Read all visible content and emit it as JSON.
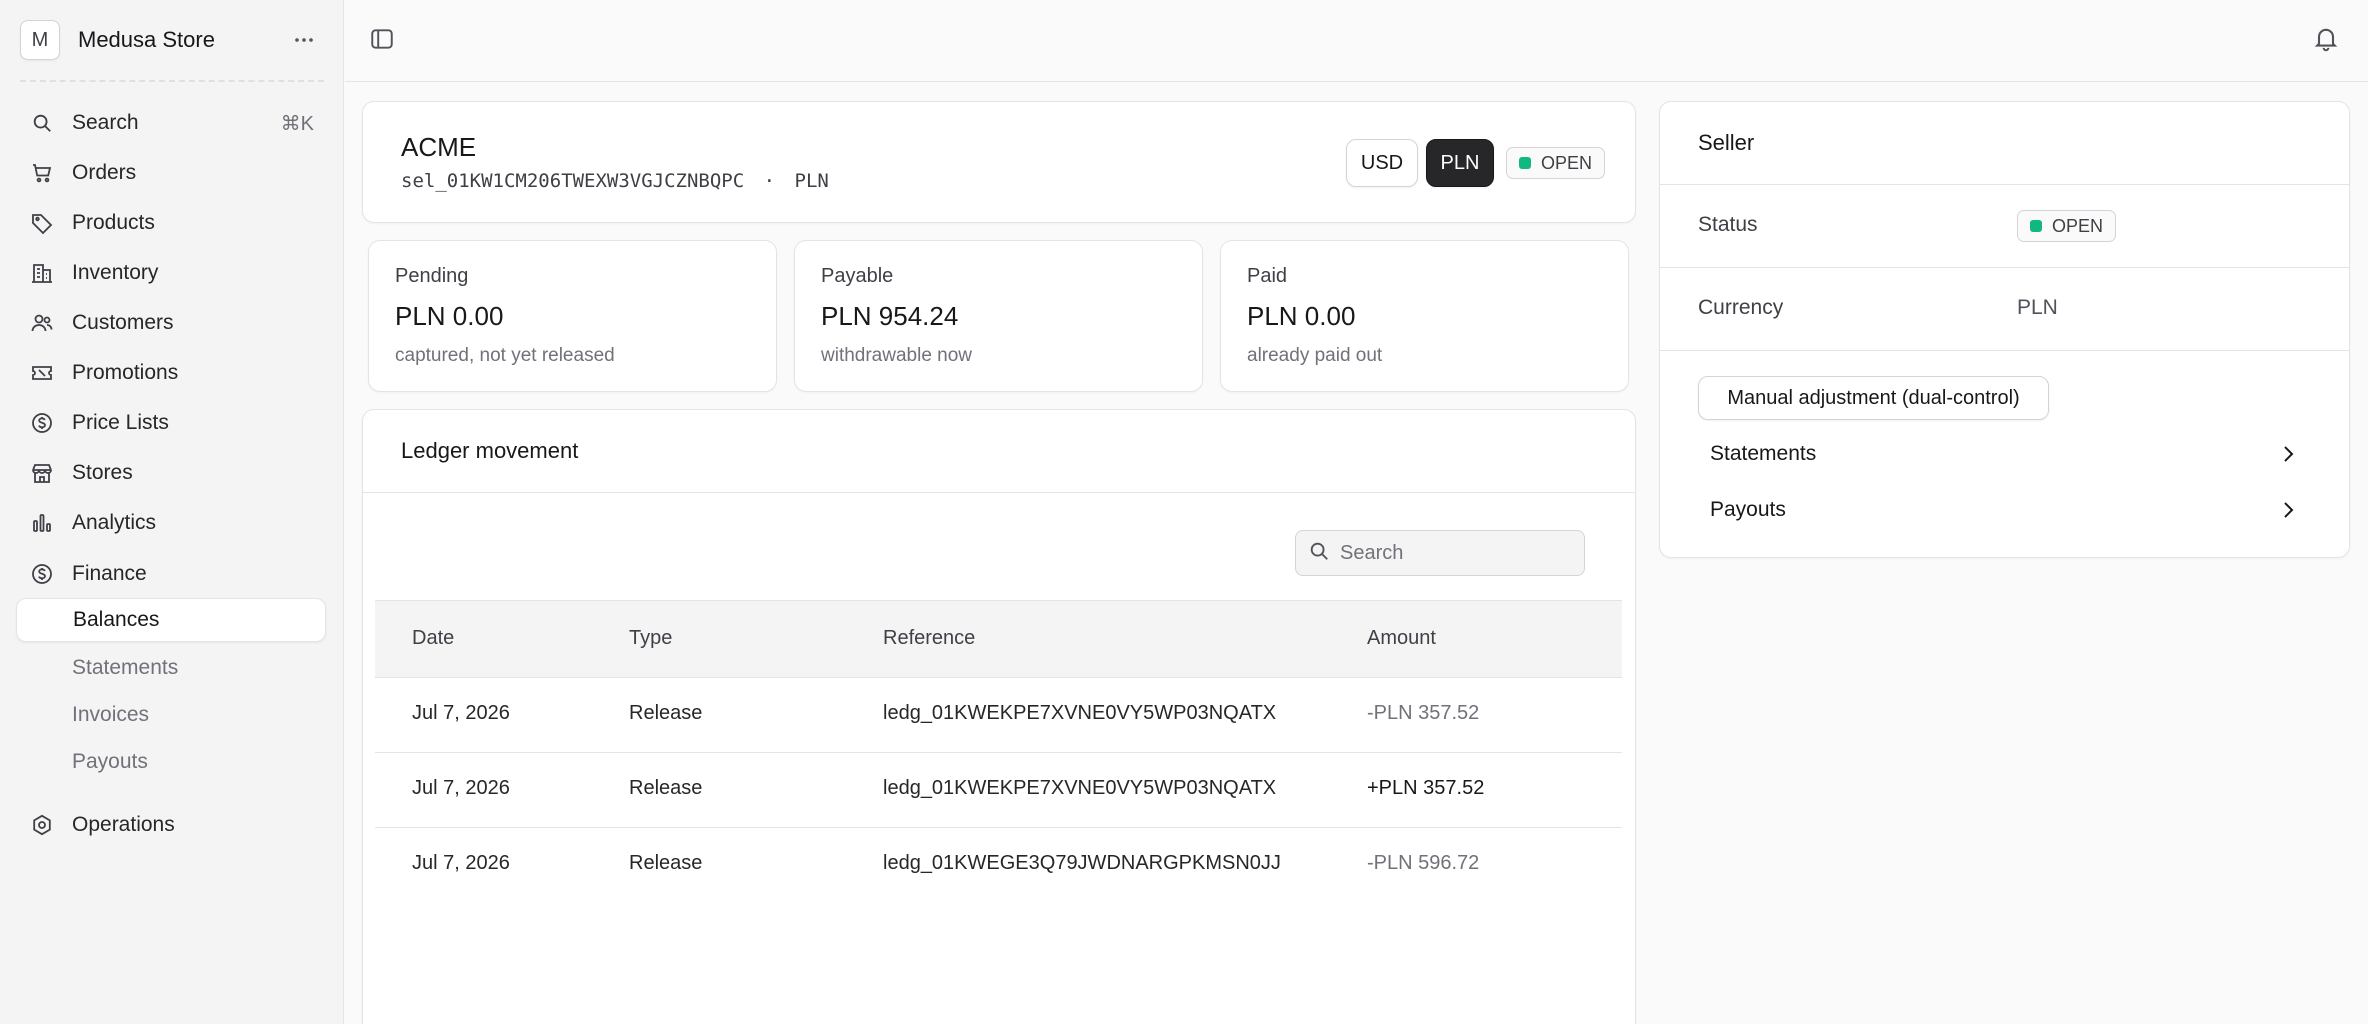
{
  "sidebar": {
    "store_initial": "M",
    "store_name": "Medusa Store",
    "search_label": "Search",
    "search_shortcut": "⌘K",
    "items": [
      {
        "label": "Orders",
        "icon": "cart-icon"
      },
      {
        "label": "Products",
        "icon": "tag-icon"
      },
      {
        "label": "Inventory",
        "icon": "building-icon"
      },
      {
        "label": "Customers",
        "icon": "users-icon"
      },
      {
        "label": "Promotions",
        "icon": "ticket-icon"
      },
      {
        "label": "Price Lists",
        "icon": "dollar-circle-icon"
      },
      {
        "label": "Stores",
        "icon": "store-icon"
      },
      {
        "label": "Analytics",
        "icon": "bar-chart-icon"
      },
      {
        "label": "Finance",
        "icon": "dollar-circle-icon"
      }
    ],
    "finance_sub": [
      {
        "label": "Balances",
        "active": true
      },
      {
        "label": "Statements",
        "active": false
      },
      {
        "label": "Invoices",
        "active": false
      },
      {
        "label": "Payouts",
        "active": false
      }
    ],
    "operations_label": "Operations"
  },
  "header": {
    "title": "ACME",
    "seller_id": "sel_01KW1CM206TWEXW3VGJCZNBQPC",
    "separator": "·",
    "currency": "PLN",
    "currency_buttons": [
      "USD",
      "PLN"
    ],
    "selected_currency": "PLN",
    "status": "OPEN"
  },
  "stats": [
    {
      "label": "Pending",
      "value": "PLN 0.00",
      "sub": "captured, not yet released"
    },
    {
      "label": "Payable",
      "value": "PLN 954.24",
      "sub": "withdrawable now"
    },
    {
      "label": "Paid",
      "value": "PLN 0.00",
      "sub": "already paid out"
    }
  ],
  "ledger": {
    "title": "Ledger movement",
    "search_placeholder": "Search",
    "columns": [
      "Date",
      "Type",
      "Reference",
      "Amount"
    ],
    "rows": [
      {
        "date": "Jul 7, 2026",
        "type": "Release",
        "reference": "ledg_01KWEKPE7XVNE0VY5WP03NQATX",
        "amount": "-PLN 357.52",
        "negative": true
      },
      {
        "date": "Jul 7, 2026",
        "type": "Release",
        "reference": "ledg_01KWEKPE7XVNE0VY5WP03NQATX",
        "amount": "+PLN 357.52",
        "negative": false
      },
      {
        "date": "Jul 7, 2026",
        "type": "Release",
        "reference": "ledg_01KWEGE3Q79JWDNARGPKMSN0JJ",
        "amount": "-PLN 596.72",
        "negative": true
      }
    ]
  },
  "seller": {
    "title": "Seller",
    "status_label": "Status",
    "status_value": "OPEN",
    "currency_label": "Currency",
    "currency_value": "PLN",
    "adjust_button": "Manual adjustment (dual-control)",
    "links": [
      "Statements",
      "Payouts"
    ]
  },
  "colors": {
    "status_green": "#10b981",
    "dark_button": "#27272a",
    "background": "#fafafa"
  }
}
